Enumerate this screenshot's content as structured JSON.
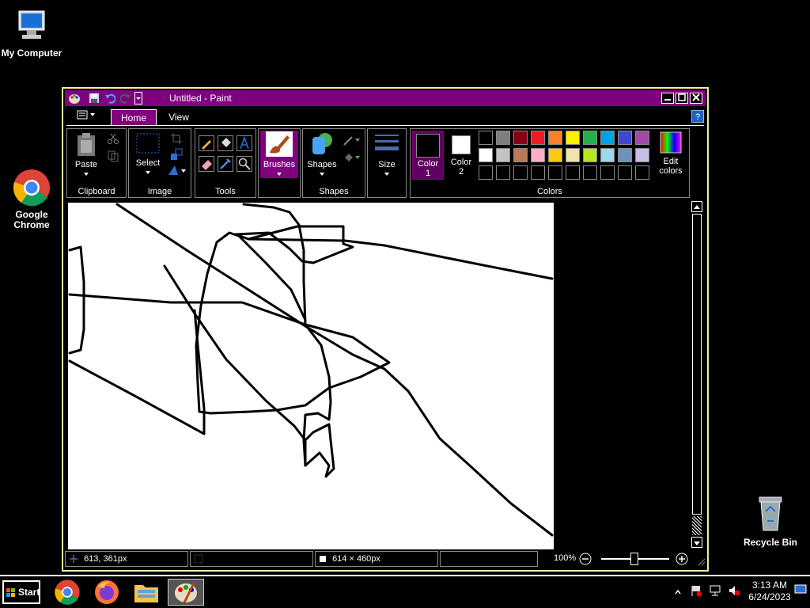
{
  "desktop": {
    "icons": [
      {
        "label": "My Computer",
        "icon": "computer-icon"
      },
      {
        "label": "Google Chrome",
        "icon": "chrome-icon"
      },
      {
        "label": "Recycle Bin",
        "icon": "recycle-bin-icon"
      }
    ]
  },
  "window": {
    "title": "Untitled - Paint",
    "tabs": {
      "home": "Home",
      "view": "View"
    },
    "ribbon": {
      "paste": "Paste",
      "select": "Select",
      "brushes": "Brushes",
      "shapes": "Shapes",
      "size": "Size",
      "color1": "Color 1",
      "color2": "Color 2",
      "edit_colors": "Edit colors",
      "groups": [
        "Clipboard",
        "Image",
        "Tools",
        "Shapes",
        "Colors"
      ]
    },
    "palette": {
      "row1": [
        "#000000",
        "#7f7f7f",
        "#880015",
        "#ed1c24",
        "#ff7f27",
        "#fff200",
        "#22b14c",
        "#00a2e8",
        "#3f48cc",
        "#a349a4"
      ],
      "row2": [
        "#ffffff",
        "#c3c3c3",
        "#b97a57",
        "#ffaec9",
        "#ffc90e",
        "#efe4b0",
        "#b5e61d",
        "#99d9ea",
        "#7092be",
        "#c8bfe7"
      ]
    },
    "status": {
      "cursor_pos": "613, 361px",
      "canvas_size": "614 × 460px",
      "zoom": "100%"
    }
  },
  "taskbar": {
    "start": "Start",
    "time": "3:13 AM",
    "date": "6/24/2023"
  }
}
